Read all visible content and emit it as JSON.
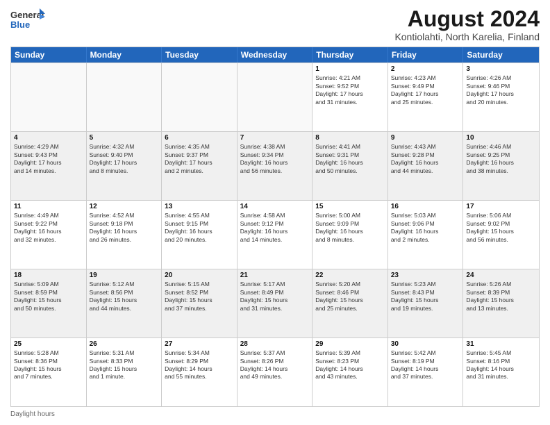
{
  "header": {
    "logo_general": "General",
    "logo_blue": "Blue",
    "title": "August 2024",
    "subtitle": "Kontiolahti, North Karelia, Finland"
  },
  "days_of_week": [
    "Sunday",
    "Monday",
    "Tuesday",
    "Wednesday",
    "Thursday",
    "Friday",
    "Saturday"
  ],
  "weeks": [
    [
      {
        "day": "",
        "info": "",
        "empty": true
      },
      {
        "day": "",
        "info": "",
        "empty": true
      },
      {
        "day": "",
        "info": "",
        "empty": true
      },
      {
        "day": "",
        "info": "",
        "empty": true
      },
      {
        "day": "1",
        "info": "Sunrise: 4:21 AM\nSunset: 9:52 PM\nDaylight: 17 hours\nand 31 minutes.",
        "empty": false
      },
      {
        "day": "2",
        "info": "Sunrise: 4:23 AM\nSunset: 9:49 PM\nDaylight: 17 hours\nand 25 minutes.",
        "empty": false
      },
      {
        "day": "3",
        "info": "Sunrise: 4:26 AM\nSunset: 9:46 PM\nDaylight: 17 hours\nand 20 minutes.",
        "empty": false
      }
    ],
    [
      {
        "day": "4",
        "info": "Sunrise: 4:29 AM\nSunset: 9:43 PM\nDaylight: 17 hours\nand 14 minutes.",
        "empty": false
      },
      {
        "day": "5",
        "info": "Sunrise: 4:32 AM\nSunset: 9:40 PM\nDaylight: 17 hours\nand 8 minutes.",
        "empty": false
      },
      {
        "day": "6",
        "info": "Sunrise: 4:35 AM\nSunset: 9:37 PM\nDaylight: 17 hours\nand 2 minutes.",
        "empty": false
      },
      {
        "day": "7",
        "info": "Sunrise: 4:38 AM\nSunset: 9:34 PM\nDaylight: 16 hours\nand 56 minutes.",
        "empty": false
      },
      {
        "day": "8",
        "info": "Sunrise: 4:41 AM\nSunset: 9:31 PM\nDaylight: 16 hours\nand 50 minutes.",
        "empty": false
      },
      {
        "day": "9",
        "info": "Sunrise: 4:43 AM\nSunset: 9:28 PM\nDaylight: 16 hours\nand 44 minutes.",
        "empty": false
      },
      {
        "day": "10",
        "info": "Sunrise: 4:46 AM\nSunset: 9:25 PM\nDaylight: 16 hours\nand 38 minutes.",
        "empty": false
      }
    ],
    [
      {
        "day": "11",
        "info": "Sunrise: 4:49 AM\nSunset: 9:22 PM\nDaylight: 16 hours\nand 32 minutes.",
        "empty": false
      },
      {
        "day": "12",
        "info": "Sunrise: 4:52 AM\nSunset: 9:18 PM\nDaylight: 16 hours\nand 26 minutes.",
        "empty": false
      },
      {
        "day": "13",
        "info": "Sunrise: 4:55 AM\nSunset: 9:15 PM\nDaylight: 16 hours\nand 20 minutes.",
        "empty": false
      },
      {
        "day": "14",
        "info": "Sunrise: 4:58 AM\nSunset: 9:12 PM\nDaylight: 16 hours\nand 14 minutes.",
        "empty": false
      },
      {
        "day": "15",
        "info": "Sunrise: 5:00 AM\nSunset: 9:09 PM\nDaylight: 16 hours\nand 8 minutes.",
        "empty": false
      },
      {
        "day": "16",
        "info": "Sunrise: 5:03 AM\nSunset: 9:06 PM\nDaylight: 16 hours\nand 2 minutes.",
        "empty": false
      },
      {
        "day": "17",
        "info": "Sunrise: 5:06 AM\nSunset: 9:02 PM\nDaylight: 15 hours\nand 56 minutes.",
        "empty": false
      }
    ],
    [
      {
        "day": "18",
        "info": "Sunrise: 5:09 AM\nSunset: 8:59 PM\nDaylight: 15 hours\nand 50 minutes.",
        "empty": false
      },
      {
        "day": "19",
        "info": "Sunrise: 5:12 AM\nSunset: 8:56 PM\nDaylight: 15 hours\nand 44 minutes.",
        "empty": false
      },
      {
        "day": "20",
        "info": "Sunrise: 5:15 AM\nSunset: 8:52 PM\nDaylight: 15 hours\nand 37 minutes.",
        "empty": false
      },
      {
        "day": "21",
        "info": "Sunrise: 5:17 AM\nSunset: 8:49 PM\nDaylight: 15 hours\nand 31 minutes.",
        "empty": false
      },
      {
        "day": "22",
        "info": "Sunrise: 5:20 AM\nSunset: 8:46 PM\nDaylight: 15 hours\nand 25 minutes.",
        "empty": false
      },
      {
        "day": "23",
        "info": "Sunrise: 5:23 AM\nSunset: 8:43 PM\nDaylight: 15 hours\nand 19 minutes.",
        "empty": false
      },
      {
        "day": "24",
        "info": "Sunrise: 5:26 AM\nSunset: 8:39 PM\nDaylight: 15 hours\nand 13 minutes.",
        "empty": false
      }
    ],
    [
      {
        "day": "25",
        "info": "Sunrise: 5:28 AM\nSunset: 8:36 PM\nDaylight: 15 hours\nand 7 minutes.",
        "empty": false
      },
      {
        "day": "26",
        "info": "Sunrise: 5:31 AM\nSunset: 8:33 PM\nDaylight: 15 hours\nand 1 minute.",
        "empty": false
      },
      {
        "day": "27",
        "info": "Sunrise: 5:34 AM\nSunset: 8:29 PM\nDaylight: 14 hours\nand 55 minutes.",
        "empty": false
      },
      {
        "day": "28",
        "info": "Sunrise: 5:37 AM\nSunset: 8:26 PM\nDaylight: 14 hours\nand 49 minutes.",
        "empty": false
      },
      {
        "day": "29",
        "info": "Sunrise: 5:39 AM\nSunset: 8:23 PM\nDaylight: 14 hours\nand 43 minutes.",
        "empty": false
      },
      {
        "day": "30",
        "info": "Sunrise: 5:42 AM\nSunset: 8:19 PM\nDaylight: 14 hours\nand 37 minutes.",
        "empty": false
      },
      {
        "day": "31",
        "info": "Sunrise: 5:45 AM\nSunset: 8:16 PM\nDaylight: 14 hours\nand 31 minutes.",
        "empty": false
      }
    ]
  ],
  "footer": {
    "daylight_label": "Daylight hours"
  }
}
